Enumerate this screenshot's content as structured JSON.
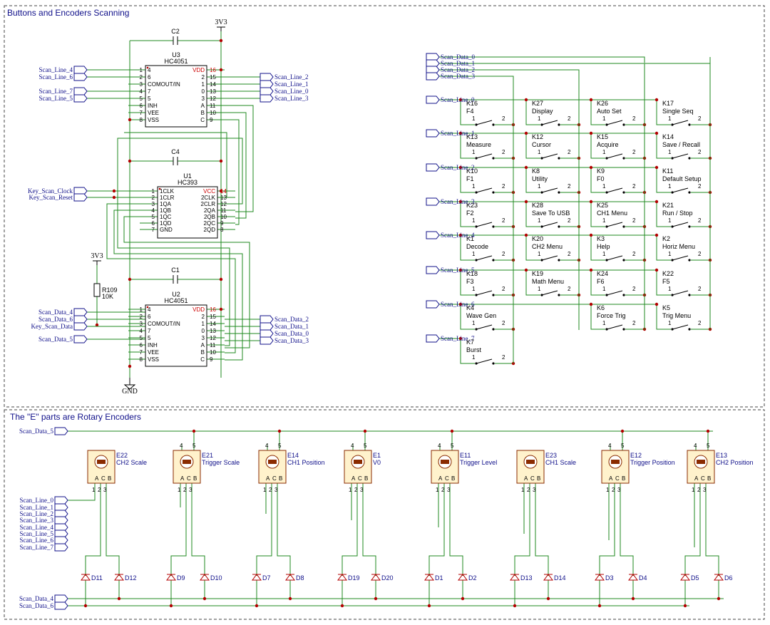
{
  "sections": {
    "top_title": "Buttons and Encoders Scanning",
    "bottom_title": "The \"E\" parts are Rotary Encoders"
  },
  "power": {
    "v1": "3V3",
    "v2": "3V3",
    "gnd": "GND"
  },
  "caps": [
    "C2",
    "C4",
    "C1"
  ],
  "resistor": {
    "ref": "R109",
    "val": "10K"
  },
  "u3": {
    "ref": "U3",
    "part": "HC4051",
    "left_pins": [
      {
        "n": "16",
        "nm": "VDD"
      },
      {
        "n": "15",
        "nm": "2"
      },
      {
        "n": "14",
        "nm": "1"
      },
      {
        "n": "13",
        "nm": "0"
      },
      {
        "n": "12",
        "nm": "3"
      },
      {
        "n": "11",
        "nm": "A"
      },
      {
        "n": "10",
        "nm": "B"
      },
      {
        "n": "9",
        "nm": "C"
      }
    ],
    "right_pins": [
      {
        "n": "1",
        "nm": "4"
      },
      {
        "n": "2",
        "nm": "6"
      },
      {
        "n": "3",
        "nm": "COMOUT/IN"
      },
      {
        "n": "4",
        "nm": "7"
      },
      {
        "n": "5",
        "nm": "5"
      },
      {
        "n": "6",
        "nm": "INH"
      },
      {
        "n": "7",
        "nm": "VEE"
      },
      {
        "n": "8",
        "nm": "VSS"
      }
    ]
  },
  "u1": {
    "ref": "U1",
    "part": "HC393",
    "left_pins": [
      {
        "n": "1",
        "nm": "1CLK"
      },
      {
        "n": "2",
        "nm": "1CLR"
      },
      {
        "n": "3",
        "nm": "1QA"
      },
      {
        "n": "4",
        "nm": "1QB"
      },
      {
        "n": "5",
        "nm": "1QC"
      },
      {
        "n": "6",
        "nm": "1QD"
      },
      {
        "n": "7",
        "nm": "GND"
      }
    ],
    "right_pins": [
      {
        "n": "14",
        "nm": "VCC"
      },
      {
        "n": "13",
        "nm": "2CLK"
      },
      {
        "n": "12",
        "nm": "2CLR"
      },
      {
        "n": "11",
        "nm": "2QA"
      },
      {
        "n": "10",
        "nm": "2QB"
      },
      {
        "n": "9",
        "nm": "2QC"
      },
      {
        "n": "8",
        "nm": "2QD"
      }
    ]
  },
  "u2": {
    "ref": "U2",
    "part": "HC4051"
  },
  "net_labels": {
    "u3_left": [
      "Scan_Line_4",
      "Scan_Line_6",
      "Scan_Line_7",
      "Scan_Line_5"
    ],
    "u3_right": [
      "Scan_Line_2",
      "Scan_Line_1",
      "Scan_Line_0",
      "Scan_Line_3"
    ],
    "u1_left": [
      "Key_Scan_Clock",
      "Key_Scan_Reset"
    ],
    "u2_left": [
      "Scan_Data_4",
      "Scan_Data_6",
      "Key_Scan_Data",
      "Scan_Data_5"
    ],
    "u2_right": [
      "Scan_Data_2",
      "Scan_Data_1",
      "Scan_Data_0",
      "Scan_Data_3"
    ],
    "matrix_data": [
      "Scan_Data_0",
      "Scan_Data_1",
      "Scan_Data_2",
      "Scan_Data_3"
    ],
    "matrix_lines": [
      "Scan_Line_0",
      "Scan_Line_1",
      "Scan_Line_2",
      "Scan_Line_3",
      "Scan_Line_4",
      "Scan_Line_5",
      "Scan_Line_6",
      "Scan_Line_7"
    ],
    "enc_top": "Scan_Data_5",
    "enc_lines": [
      "Scan_Line_0",
      "Scan_Line_1",
      "Scan_Line_2",
      "Scan_Line_3",
      "Scan_Line_4",
      "Scan_Line_5",
      "Scan_Line_6",
      "Scan_Line_7"
    ],
    "enc_bottom": [
      "Scan_Data_4",
      "Scan_Data_6"
    ]
  },
  "keys": [
    [
      {
        "ref": "K16",
        "label": "F4"
      },
      {
        "ref": "K27",
        "label": "Display"
      },
      {
        "ref": "K26",
        "label": "Auto Set"
      },
      {
        "ref": "K17",
        "label": "Single Seq"
      }
    ],
    [
      {
        "ref": "K13",
        "label": "Measure"
      },
      {
        "ref": "K12",
        "label": "Cursor"
      },
      {
        "ref": "K15",
        "label": "Acquire"
      },
      {
        "ref": "K14",
        "label": "Save / Recall"
      }
    ],
    [
      {
        "ref": "K10",
        "label": "F1"
      },
      {
        "ref": "K8",
        "label": "Utility"
      },
      {
        "ref": "K9",
        "label": "F0"
      },
      {
        "ref": "K11",
        "label": "Default Setup"
      }
    ],
    [
      {
        "ref": "K23",
        "label": "F2"
      },
      {
        "ref": "K28",
        "label": "Save To USB"
      },
      {
        "ref": "K25",
        "label": "CH1 Menu"
      },
      {
        "ref": "K21",
        "label": "Run / Stop"
      }
    ],
    [
      {
        "ref": "K1",
        "label": "Decode"
      },
      {
        "ref": "K20",
        "label": "CH2 Menu"
      },
      {
        "ref": "K3",
        "label": "Help"
      },
      {
        "ref": "K2",
        "label": "Horiz Menu"
      }
    ],
    [
      {
        "ref": "K18",
        "label": "F3"
      },
      {
        "ref": "K19",
        "label": "Math Menu"
      },
      {
        "ref": "K24",
        "label": "F6"
      },
      {
        "ref": "K22",
        "label": "F5"
      }
    ],
    [
      {
        "ref": "K4",
        "label": "Wave Gen"
      },
      null,
      {
        "ref": "K6",
        "label": "Force Trig"
      },
      {
        "ref": "K5",
        "label": "Trig Menu"
      }
    ],
    [
      {
        "ref": "K7",
        "label": "Burst"
      },
      null,
      null,
      null
    ]
  ],
  "switch_pins": [
    "1",
    "2"
  ],
  "encoders": [
    {
      "ref": "E22",
      "label": "CH2 Scale"
    },
    {
      "ref": "E21",
      "label": "Trigger Scale"
    },
    {
      "ref": "E14",
      "label": "CH1 Position"
    },
    {
      "ref": "E1",
      "label": "V0"
    },
    {
      "ref": "E11",
      "label": "Trigger Level"
    },
    {
      "ref": "E23",
      "label": "CH1 Scale"
    },
    {
      "ref": "E12",
      "label": "Trigger Position"
    },
    {
      "ref": "E13",
      "label": "CH2 Position"
    }
  ],
  "encoder_pins": {
    "top": [
      "4",
      "5"
    ],
    "bottom": [
      "1",
      "2",
      "3"
    ],
    "body": [
      "A",
      "C",
      "B"
    ]
  },
  "diodes": [
    "D11",
    "D12",
    "D9",
    "D10",
    "D7",
    "D8",
    "D19",
    "D20",
    "D1",
    "D2",
    "D13",
    "D14",
    "D3",
    "D4",
    "D5",
    "D6"
  ]
}
